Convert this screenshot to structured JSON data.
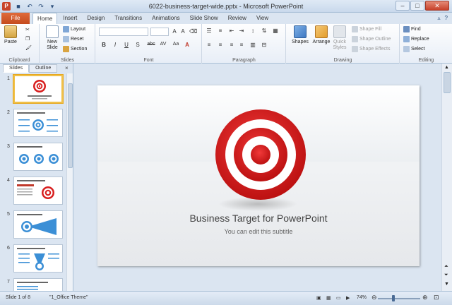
{
  "window": {
    "title": "6022-business-target-wide.pptx - Microsoft PowerPoint",
    "app_icon": "P",
    "quick_access": [
      "save-icon",
      "undo-icon",
      "redo-icon",
      "customize-icon"
    ],
    "controls": [
      "minimize",
      "maximize",
      "close"
    ]
  },
  "ribbon_tabs": {
    "file": "File",
    "tabs": [
      "Home",
      "Insert",
      "Design",
      "Transitions",
      "Animations",
      "Slide Show",
      "Review",
      "View"
    ],
    "active": "Home"
  },
  "ribbon": {
    "clipboard": {
      "label": "Clipboard",
      "paste": "Paste"
    },
    "slides": {
      "label": "Slides",
      "new_slide": "New Slide",
      "layout": "Layout",
      "reset": "Reset",
      "section": "Section"
    },
    "font": {
      "label": "Font",
      "buttons": [
        "B",
        "I",
        "U",
        "S",
        "abc",
        "AV",
        "Aa",
        "A"
      ]
    },
    "paragraph": {
      "label": "Paragraph"
    },
    "drawing": {
      "label": "Drawing",
      "shapes": "Shapes",
      "arrange": "Arrange",
      "quick_styles": "Quick Styles",
      "shape_fill": "Shape Fill",
      "shape_outline": "Shape Outline",
      "shape_effects": "Shape Effects"
    },
    "editing": {
      "label": "Editing",
      "find": "Find",
      "replace": "Replace",
      "select": "Select"
    }
  },
  "left_pane": {
    "tabs": [
      "Slides",
      "Outline"
    ],
    "active_tab": "Slides",
    "close": "×",
    "slides": [
      {
        "num": "1",
        "selected": true
      },
      {
        "num": "2",
        "selected": false
      },
      {
        "num": "3",
        "selected": false
      },
      {
        "num": "4",
        "selected": false
      },
      {
        "num": "5",
        "selected": false
      },
      {
        "num": "6",
        "selected": false
      },
      {
        "num": "7",
        "selected": false
      }
    ]
  },
  "slide": {
    "title": "Business Target for PowerPoint",
    "subtitle": "You can edit this subtitle",
    "accent": "#d81e1e"
  },
  "status": {
    "slide_of": "Slide 1 of 8",
    "theme": "\"1_Office Theme\"",
    "zoom": "74%",
    "zoom_fraction": 0.37
  }
}
